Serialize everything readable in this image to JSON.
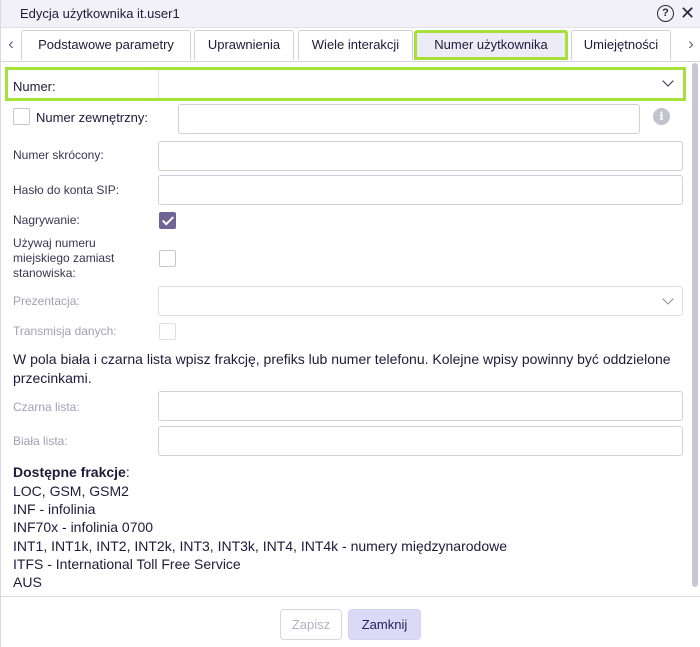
{
  "window": {
    "title": "Edycja użytkownika it.user1"
  },
  "tabs": [
    {
      "label": "Podstawowe parametry"
    },
    {
      "label": "Uprawnienia"
    },
    {
      "label": "Wiele interakcji"
    },
    {
      "label": "Numer użytkownika",
      "active": true
    },
    {
      "label": "Umiejętności"
    }
  ],
  "form": {
    "numer_label": "Numer:",
    "numer_value": "",
    "external_label": "Numer zewnętrzny:",
    "external_value": "",
    "short_label": "Numer skrócony:",
    "short_value": "",
    "sip_label": "Hasło do konta SIP:",
    "sip_value": "",
    "recording_label": "Nagrywanie:",
    "recording_checked": true,
    "city_number_label_1": "Używaj numeru",
    "city_number_label_2": "miejskiego zamiast",
    "city_number_label_3": "stanowiska:",
    "presentation_label": "Prezentacja:",
    "presentation_value": "",
    "data_transmission_label": "Transmisja danych:",
    "lists_note": "W pola biała i czarna lista wpisz frakcję, prefiks lub numer telefonu. Kolejne wpisy powinny być oddzielone przecinkami.",
    "blacklist_label": "Czarna lista:",
    "whitelist_label": "Biała lista:"
  },
  "fractions": {
    "title": "Dostępne frakcje",
    "title_suffix": ":",
    "lines": [
      "LOC, GSM, GSM2",
      "INF - infolinia",
      "INF70x - infolinia 0700",
      "INT1, INT1k, INT2, INT2k, INT3, INT3k, INT4, INT4k - numery międzynarodowe",
      "ITFS - International Toll Free Service",
      "AUS"
    ]
  },
  "footer": {
    "save_label": "Zapisz",
    "close_label": "Zamknij"
  },
  "icons": {
    "help": "?",
    "close": "✕",
    "info": "i",
    "tab_left": "‹",
    "tab_right": "›"
  },
  "colors": {
    "highlight": "#a6e03a",
    "accent": "#6e6495",
    "primary_button": "#dcd9f6"
  }
}
